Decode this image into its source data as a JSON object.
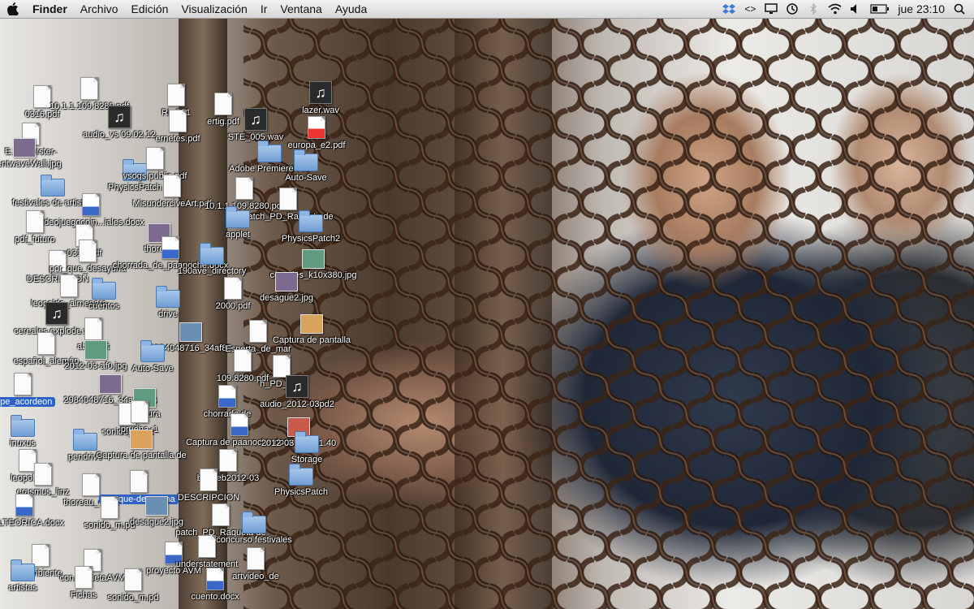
{
  "menubar": {
    "apple_icon": "apple-logo-icon",
    "app_name": "Finder",
    "menus": [
      "Archivo",
      "Edición",
      "Visualización",
      "Ir",
      "Ventana",
      "Ayuda"
    ],
    "status": {
      "icons": [
        "dropbox-icon",
        "code-brackets-icon",
        "display-icon",
        "time-machine-icon",
        "bluetooth-icon",
        "wifi-icon",
        "volume-icon",
        "battery-icon"
      ],
      "clock": "jue 23:10",
      "search_icon": "spotlight-search-icon"
    }
  },
  "desktop": {
    "icons": [
      {
        "label": "0316.pdf",
        "kind": "doc"
      },
      {
        "label": "10.1.1.109.8280.pdf",
        "kind": "doc"
      },
      {
        "label": "RL-091",
        "kind": "doc"
      },
      {
        "label": "ertig.pdf",
        "kind": "doc"
      },
      {
        "label": "lazer.wav",
        "kind": "audio"
      },
      {
        "label": "E.M. Forster-",
        "kind": "doc"
      },
      {
        "label": "audio_vs 09.02.12",
        "kind": "audio"
      },
      {
        "label": "ernetes.pdf",
        "kind": "doc"
      },
      {
        "label": "STE_005.wav",
        "kind": "audio"
      },
      {
        "label": "europa_e2.pdf",
        "kind": "pdf"
      },
      {
        "label": "eventwaveWall.jpg",
        "kind": "thumb"
      },
      {
        "label": "PhysicsPatch",
        "kind": "folder"
      },
      {
        "label": "vsogs.public.pdf",
        "kind": "doc"
      },
      {
        "label": "Adobe Premiere Pro",
        "kind": "folder"
      },
      {
        "label": "Auto-Save",
        "kind": "folder"
      },
      {
        "label": "festivales de artistas",
        "kind": "folder"
      },
      {
        "label": "videojuegocoin...iales.docx",
        "kind": "docx"
      },
      {
        "label": "MisunderciveArt.pdf",
        "kind": "doc"
      },
      {
        "label": "10.1.1.109.8280.pdf",
        "kind": "doc"
      },
      {
        "label": "patch_PD_Raqueta de",
        "kind": "doc"
      },
      {
        "label": "pdf_futuro",
        "kind": "doc"
      },
      {
        "label": "0316.pdf",
        "kind": "doc"
      },
      {
        "label": "thoreau",
        "kind": "thumb"
      },
      {
        "label": "applet",
        "kind": "folder"
      },
      {
        "label": "PhysicsPatch2",
        "kind": "folder"
      },
      {
        "label": "DESCRIPCION",
        "kind": "doc"
      },
      {
        "label": "por_que_desayuna",
        "kind": "doc"
      },
      {
        "label": "chorrada_de_paanoche.docx",
        "kind": "docx"
      },
      {
        "label": "190ave_directory",
        "kind": "folder"
      },
      {
        "label": "cereales_k10x380.jpg",
        "kind": "thumb"
      },
      {
        "label": "leopoldo_almenara",
        "kind": "doc"
      },
      {
        "label": "cuentos",
        "kind": "folder"
      },
      {
        "label": "drive",
        "kind": "folder"
      },
      {
        "label": "2000.pdf",
        "kind": "doc"
      },
      {
        "label": "desague2.jpg",
        "kind": "thumb"
      },
      {
        "label": "cereales.explode.wav",
        "kind": "audio"
      },
      {
        "label": "abor_int",
        "kind": "doc"
      },
      {
        "label": "2984048716_34af89",
        "kind": "thumb"
      },
      {
        "label": "Esperta_de_mar",
        "kind": "doc"
      },
      {
        "label": "Captura de pantalla",
        "kind": "thumb"
      },
      {
        "label": "español_alemán",
        "kind": "doc"
      },
      {
        "label": "2012-03-af0.jpg",
        "kind": "thumb"
      },
      {
        "label": "Auto-Save",
        "kind": "folder"
      },
      {
        "label": "109.8280.pdf",
        "kind": "doc"
      },
      {
        "label": "h_PD_Raq",
        "kind": "doc"
      },
      {
        "label": "type_acordeon",
        "kind": "doc",
        "selected": true
      },
      {
        "label": "2984048716_34af89TS",
        "kind": "thumb"
      },
      {
        "label": "Captura",
        "kind": "thumb"
      },
      {
        "label": "chorrada de",
        "kind": "docx"
      },
      {
        "label": "audio_2012-03pd2",
        "kind": "audio"
      },
      {
        "label": "inuxus",
        "kind": "folder"
      },
      {
        "label": "sonido_m.pd",
        "kind": "doc"
      },
      {
        "label": "prueba_1",
        "kind": "doc"
      },
      {
        "label": "Captura de paanoche.docx",
        "kind": "docx"
      },
      {
        "label": "2012-03_ 23.01.40",
        "kind": "thumb"
      },
      {
        "label": "leopoldo",
        "kind": "doc"
      },
      {
        "label": "pendrive",
        "kind": "folder"
      },
      {
        "label": "Captura de pantalla de",
        "kind": "thumb"
      },
      {
        "label": "bin_feb2012-03",
        "kind": "doc"
      },
      {
        "label": "Storage",
        "kind": "folder"
      },
      {
        "label": "erasmus_linz",
        "kind": "doc"
      },
      {
        "label": "thoreau_de.ht",
        "kind": "doc"
      },
      {
        "label": "por-que-desayuna",
        "kind": "doc",
        "selected": true
      },
      {
        "label": "DESCRIPCION",
        "kind": "doc"
      },
      {
        "label": "PhysicsPatch",
        "kind": "folder"
      },
      {
        "label": "WALTEORICA.docx",
        "kind": "docx"
      },
      {
        "label": "sonido_m.pd",
        "kind": "doc"
      },
      {
        "label": "desague2.jpg",
        "kind": "thumb"
      },
      {
        "label": "patch_PD_Raqueta de",
        "kind": "doc"
      },
      {
        "label": "concurso festivales",
        "kind": "folder"
      },
      {
        "label": "escribiente",
        "kind": "doc"
      },
      {
        "label": "con raquetaAVM",
        "kind": "doc"
      },
      {
        "label": "proyecto AVM",
        "kind": "docx"
      },
      {
        "label": "understatement",
        "kind": "doc"
      },
      {
        "label": "artvideo_de",
        "kind": "doc"
      },
      {
        "label": "artistas",
        "kind": "folder"
      },
      {
        "label": "Fichas",
        "kind": "doc"
      },
      {
        "label": "sonido_m.pd",
        "kind": "doc"
      },
      {
        "label": "cuento.docx",
        "kind": "docx"
      }
    ]
  }
}
